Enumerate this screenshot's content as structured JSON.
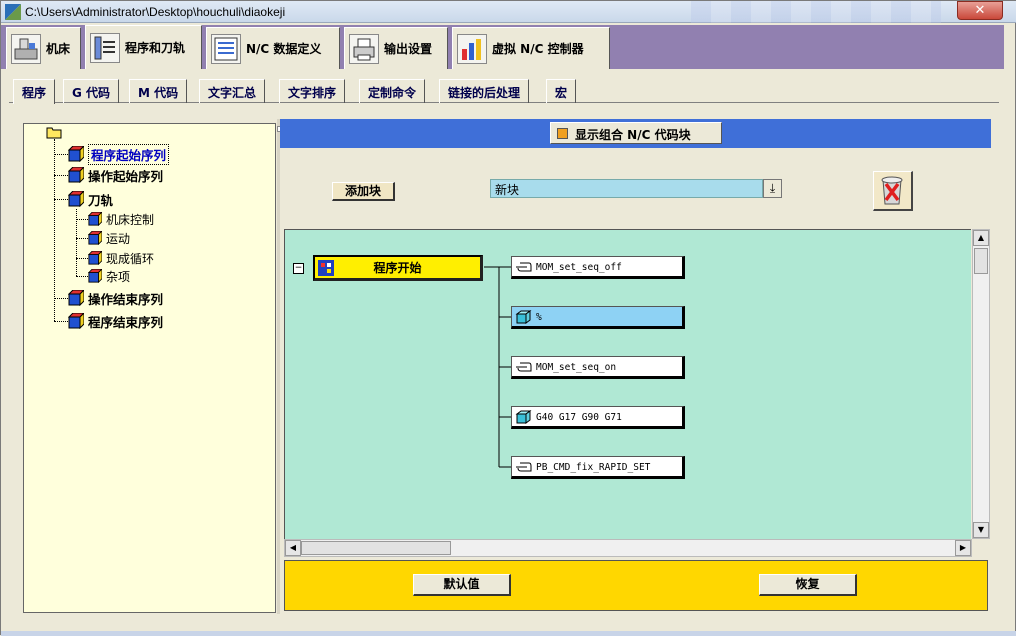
{
  "window": {
    "title": "C:\\Users\\Administrator\\Desktop\\houchuli\\diaokeji",
    "close_label": "✕"
  },
  "main_tabs": [
    {
      "label": "机床"
    },
    {
      "label": "程序和刀轨"
    },
    {
      "label": "N/C 数据定义"
    },
    {
      "label": "输出设置"
    },
    {
      "label": "虚拟 N/C 控制器"
    }
  ],
  "sub_tabs": [
    {
      "label": "程序"
    },
    {
      "label": "G 代码"
    },
    {
      "label": "M 代码"
    },
    {
      "label": "文字汇总"
    },
    {
      "label": "文字排序"
    },
    {
      "label": "定制命令"
    },
    {
      "label": "链接的后处理"
    },
    {
      "label": "宏"
    }
  ],
  "tree": {
    "items": [
      {
        "label": "程序起始序列"
      },
      {
        "label": "操作起始序列"
      },
      {
        "label": "刀轨"
      },
      {
        "label": "机床控制"
      },
      {
        "label": "运动"
      },
      {
        "label": "现成循环"
      },
      {
        "label": "杂项"
      },
      {
        "label": "操作结束序列"
      },
      {
        "label": "程序结束序列"
      }
    ]
  },
  "toolbar": {
    "combo_label": "显示组合 N/C 代码块",
    "add_block_label": "添加块",
    "new_block_value": "新块",
    "dropdown_glyph": "⤓"
  },
  "canvas": {
    "start_node_label": "程序开始",
    "collapse_glyph": "−",
    "commands": [
      {
        "label": "MOM_set_seq_off"
      },
      {
        "label": "%"
      },
      {
        "label": "MOM_set_seq_on"
      },
      {
        "label": "G40 G17 G90 G71"
      },
      {
        "label": "PB_CMD_fix_RAPID_SET"
      }
    ]
  },
  "footer": {
    "default_label": "默认值",
    "restore_label": "恢复"
  },
  "colors": {
    "canvas_bg": "#b0e8d4",
    "blue_bar": "#3f6fd8",
    "start_node": "#ffef00",
    "footer_bg": "#ffd700"
  }
}
